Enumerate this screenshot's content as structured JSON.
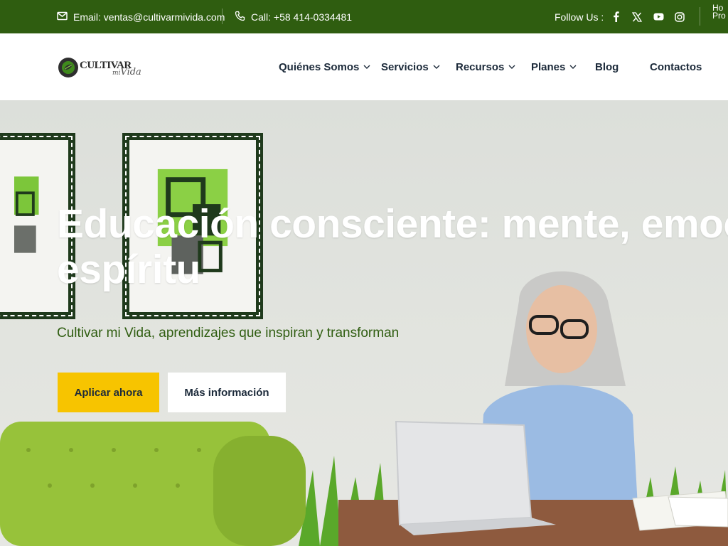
{
  "topbar": {
    "email": "Email: ventas@cultivarmivida.com",
    "phone": "Call: +58 414-0334481",
    "follow": "Follow Us :",
    "edge_text": "Ho\nPro",
    "socials": [
      "facebook-icon",
      "x-icon",
      "youtube-icon",
      "instagram-icon"
    ]
  },
  "header": {
    "logo": {
      "main": "CULTIVAR",
      "small": "mi",
      "script": "Vida"
    },
    "nav": [
      {
        "label": "Quiénes Somos",
        "has_dropdown": true
      },
      {
        "label": "Servicios",
        "has_dropdown": true
      },
      {
        "label": "Recursos",
        "has_dropdown": true
      },
      {
        "label": "Planes",
        "has_dropdown": true
      },
      {
        "label": "Blog",
        "has_dropdown": false
      },
      {
        "label": "Contactos",
        "has_dropdown": false
      }
    ]
  },
  "hero": {
    "headline_line1": "Educación consciente: mente, emoción",
    "headline_line2": "espíritu",
    "subline": "Cultivar mi Vida, aprendizajes que inspiran y transforman",
    "primary_button": "Aplicar ahora",
    "secondary_button": "Más información"
  },
  "colors": {
    "topbar_bg": "#2f5d10",
    "accent_yellow": "#f7c400",
    "nav_text": "#1c2a3a",
    "brand_green": "#2f5d10"
  }
}
